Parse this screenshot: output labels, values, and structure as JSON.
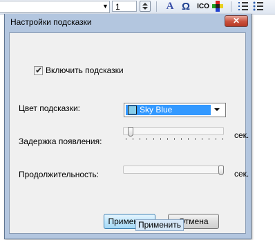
{
  "toolbar": {
    "font_size_value": "1",
    "font_color_icon": "A",
    "omega_icon": "Ω",
    "ico_label": "ICO"
  },
  "dialog": {
    "title": "Настройки подсказки",
    "close_glyph": "✕",
    "enable_checkbox": {
      "label": "Включить подсказки",
      "checked": true,
      "check_glyph": "✔"
    },
    "color": {
      "label": "Цвет подсказки:",
      "selected": "Sky Blue",
      "swatch_color": "#87ceeb"
    },
    "delay": {
      "label": "Задержка появления:",
      "unit": "сек.",
      "position_fraction": 0.05
    },
    "duration": {
      "label": "Продолжительность:",
      "unit": "сек.",
      "position_fraction": 1.0
    },
    "apply_button": "Применить",
    "cancel_button": "Отмена"
  },
  "tooltip": {
    "text": "Применить"
  },
  "colors": {
    "title_bar": "#b3c6df",
    "selection": "#3399ff",
    "close_button": "#c9503c"
  }
}
